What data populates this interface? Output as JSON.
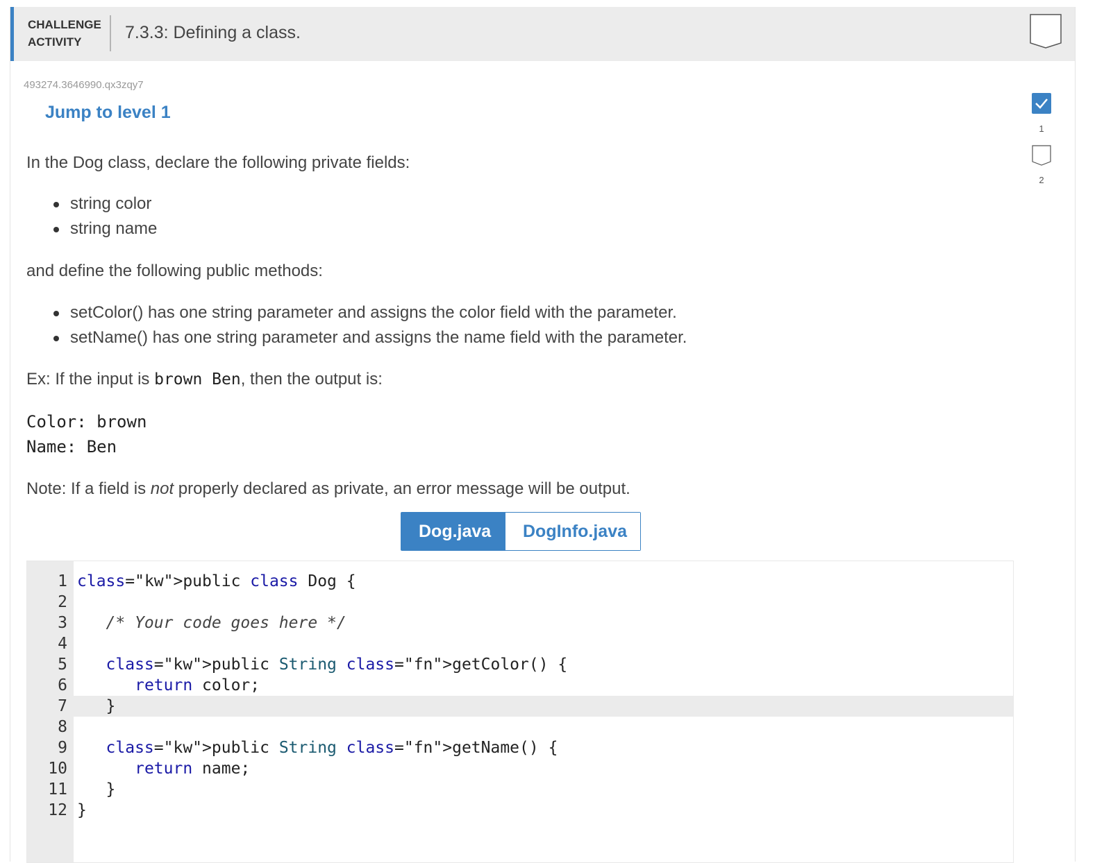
{
  "header": {
    "label_line1": "CHALLENGE",
    "label_line2": "ACTIVITY",
    "title": "7.3.3: Defining a class."
  },
  "activity_id": "493274.3646990.qx3zqy7",
  "jump_link": "Jump to level 1",
  "instructions": {
    "intro": "In the Dog class, declare the following private fields:",
    "fields": [
      "string color",
      "string name"
    ],
    "methods_intro": "and define the following public methods:",
    "methods": [
      "setColor() has one string parameter and assigns the color field with the parameter.",
      "setName() has one string parameter and assigns the name field with the parameter."
    ],
    "example_prefix": "Ex: If the input is ",
    "example_input": "brown Ben",
    "example_suffix": ", then the output is:",
    "output_lines": [
      "Color: brown",
      "Name: Ben"
    ],
    "note_prefix": "Note: If a field is ",
    "note_emphasis": "not",
    "note_suffix": " properly declared as private, an error message will be output."
  },
  "tabs": [
    {
      "label": "Dog.java",
      "active": true
    },
    {
      "label": "DogInfo.java",
      "active": false
    }
  ],
  "editor": {
    "line_numbers": [
      "1",
      "2",
      "3",
      "4",
      "5",
      "6",
      "7",
      "8",
      "9",
      "10",
      "11",
      "12"
    ],
    "lines": [
      "public class Dog {",
      "",
      "   /* Your code goes here */",
      "",
      "   public String getColor() {",
      "      return color;",
      "   }",
      "",
      "   public String getName() {",
      "      return name;",
      "   }",
      "}"
    ],
    "highlighted_line": 7
  },
  "levels": [
    {
      "number": "1",
      "completed": true
    },
    {
      "number": "2",
      "completed": false
    }
  ],
  "colors": {
    "accent": "#3b82c4",
    "header_bg": "#ececec",
    "gutter_bg": "#ebebeb"
  },
  "icons": {
    "activity_badge": "shield-outline-icon",
    "level_done": "checkmark-icon",
    "level_pending": "shield-outline-icon"
  }
}
